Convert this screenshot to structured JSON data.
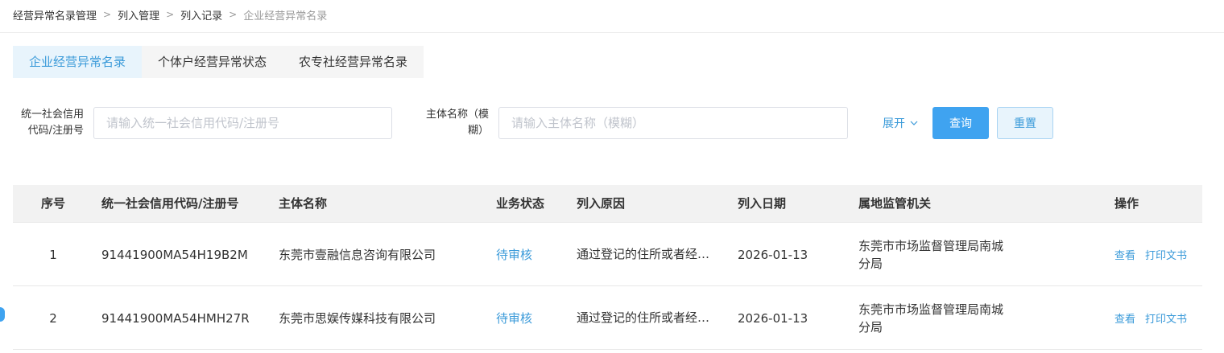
{
  "breadcrumb": [
    "经营异常名录管理",
    "列入管理",
    "列入记录",
    "企业经营异常名录"
  ],
  "breadcrumb_sep": ">",
  "tabs": [
    {
      "label": "企业经营异常名录",
      "active": true
    },
    {
      "label": "个体户经营异常状态",
      "active": false
    },
    {
      "label": "农专社经营异常名录",
      "active": false
    }
  ],
  "filters": {
    "credit_code": {
      "label_line1": "统一社会信用",
      "label_line2": "代码/注册号",
      "placeholder": "请输入统一社会信用代码/注册号",
      "value": ""
    },
    "entity_name": {
      "label_line1": "主体名称（模",
      "label_line2": "糊）",
      "placeholder": "请输入主体名称（模糊）",
      "value": ""
    },
    "expand_label": "展开",
    "search_label": "查询",
    "reset_label": "重置"
  },
  "table": {
    "headers": {
      "seq": "序号",
      "code": "统一社会信用代码/注册号",
      "name": "主体名称",
      "status": "业务状态",
      "reason": "列入原因",
      "date": "列入日期",
      "org": "属地监管机关",
      "ops": "操作"
    },
    "rows": [
      {
        "seq": "1",
        "code": "91441900MA54H19B2M",
        "name": "东莞市壹融信息咨询有限公司",
        "status": "待审核",
        "reason": "通过登记的住所或者经营场所无法联系的",
        "date": "2026-01-13",
        "org": "东莞市市场监督管理局南城分局",
        "view": "查看",
        "print": "打印文书"
      },
      {
        "seq": "2",
        "code": "91441900MA54HMH27R",
        "name": "东莞市思娱传媒科技有限公司",
        "status": "待审核",
        "reason": "通过登记的住所或者经营场所无法联系的",
        "date": "2026-01-13",
        "org": "东莞市市场监督管理局南城分局",
        "view": "查看",
        "print": "打印文书"
      }
    ]
  },
  "colors": {
    "accent": "#3a9ad9",
    "primary_button": "#3fa3f0",
    "header_bg": "#f2f2f2"
  }
}
